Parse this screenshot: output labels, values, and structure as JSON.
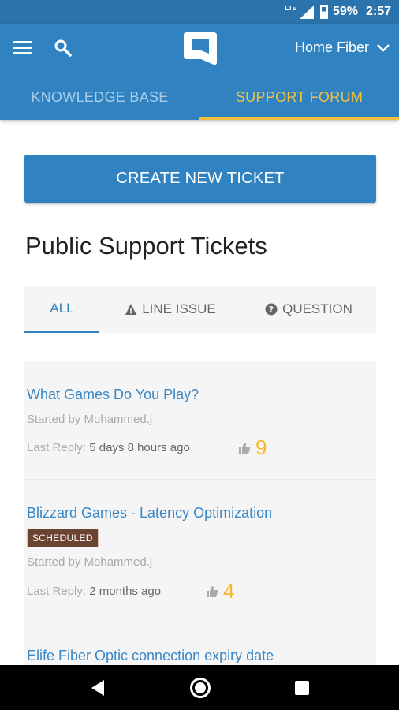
{
  "status": {
    "network": "LTE",
    "battery": "59%",
    "time": "2:57"
  },
  "header": {
    "network_label": "Home Fiber",
    "tabs": [
      {
        "label": "KNOWLEDGE BASE",
        "active": false
      },
      {
        "label": "SUPPORT FORUM",
        "active": true
      }
    ]
  },
  "actions": {
    "create_ticket": "CREATE NEW TICKET"
  },
  "main": {
    "title": "Public Support Tickets",
    "filters": [
      {
        "label": "ALL",
        "icon": "none",
        "active": true
      },
      {
        "label": "LINE ISSUE",
        "icon": "warning-icon",
        "active": false
      },
      {
        "label": "QUESTION",
        "icon": "question-circle-icon",
        "active": false
      }
    ]
  },
  "tickets": [
    {
      "title": "What Games Do You Play?",
      "badge": "",
      "starter": "Started by Mohammed.j",
      "reply_label": "Last Reply:",
      "reply_time": "5 days 8 hours ago",
      "likes": "9"
    },
    {
      "title": "Blizzard Games - Latency Optimization",
      "badge": "SCHEDULED",
      "starter": "Started by Mohammed.j",
      "reply_label": "Last Reply:",
      "reply_time": "2 months ago",
      "likes": "4"
    },
    {
      "title": "Elife Fiber Optic connection expiry date"
    }
  ],
  "colors": {
    "primary": "#3182c1",
    "accent": "#f5c23c",
    "badge": "#6b4331",
    "likes": "#f5b82e"
  }
}
